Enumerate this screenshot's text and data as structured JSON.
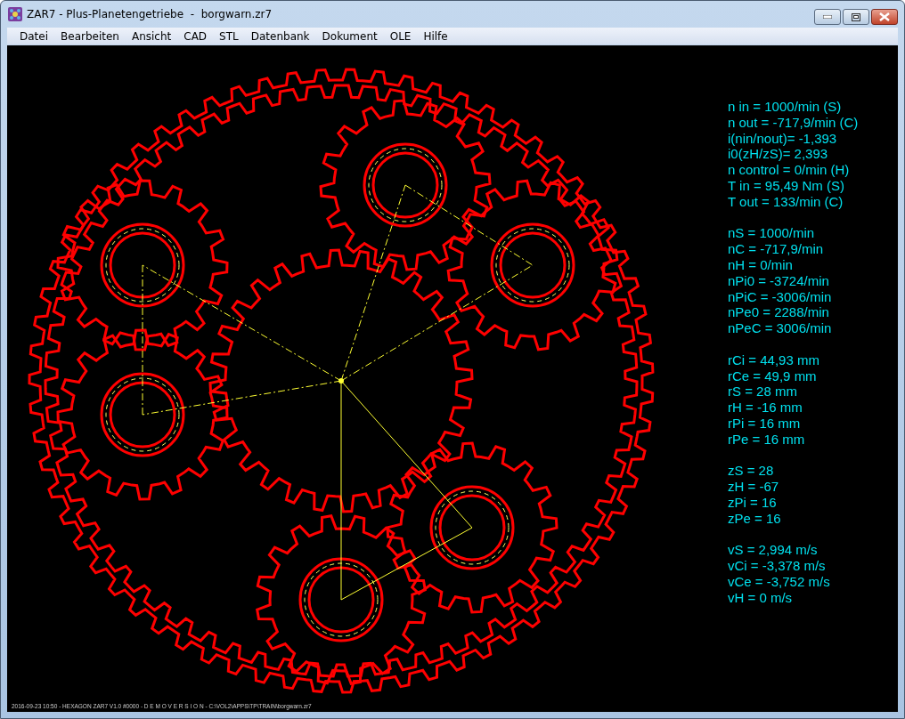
{
  "window": {
    "title": "ZAR7 - Plus-Planetengetriebe  -  borgwarn.zr7"
  },
  "menu": [
    "Datei",
    "Bearbeiten",
    "Ansicht",
    "CAD",
    "STL",
    "Datenbank",
    "Dokument",
    "OLE",
    "Hilfe"
  ],
  "readout": [
    [
      "n in = 1000/min (S)",
      "n out = -717,9/min (C)",
      "i(nin/nout)= -1,393",
      "i0(zH/zS)= 2,393",
      "n control = 0/min (H)",
      "T in = 95,49 Nm (S)",
      "T out = 133/min (C)"
    ],
    [
      "nS = 1000/min",
      "nC = -717,9/min",
      "nH = 0/min",
      "nPi0 = -3724/min",
      "nPiC = -3006/min",
      "nPe0 = 2288/min",
      "nPeC = 3006/min"
    ],
    [
      "rCi = 44,93 mm",
      "rCe = 49,9 mm",
      "rS = 28 mm",
      "rH = -16 mm",
      "rPi = 16 mm",
      "rPe = 16 mm"
    ],
    [
      "zS = 28",
      "zH = -67",
      "zPi = 16",
      "zPe = 16"
    ],
    [
      "vS = 2,994 m/s",
      "vCi = -3,378 m/s",
      "vCe = -3,752 m/s",
      "vH = 0 m/s"
    ]
  ],
  "status_line": "2016-09-23 10:50 - HEXAGON ZAR7 V1.0 #0000 - D E M O V E R S I O N - C:\\VOL2\\APPS\\TP\\TRAIN\\borgwarn.zr7"
}
